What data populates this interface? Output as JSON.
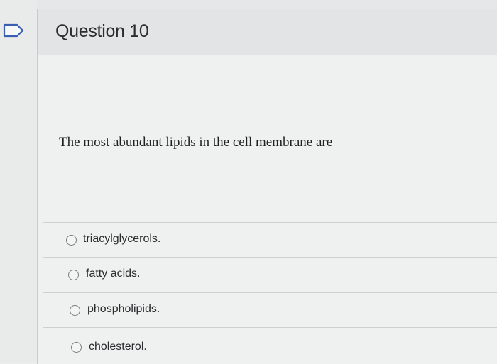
{
  "question": {
    "title": "Question 10",
    "text": "The most abundant lipids in the cell membrane are",
    "options": [
      {
        "label": "triacylglycerols."
      },
      {
        "label": "fatty acids."
      },
      {
        "label": "phospholipids."
      },
      {
        "label": "cholesterol."
      }
    ]
  },
  "icons": {
    "flag": "flag-icon",
    "radio": "radio-unselected-icon"
  },
  "colors": {
    "header_bg": "#e3e4e5",
    "flag_stroke": "#3a5fb0",
    "text": "#2b2d2f"
  }
}
